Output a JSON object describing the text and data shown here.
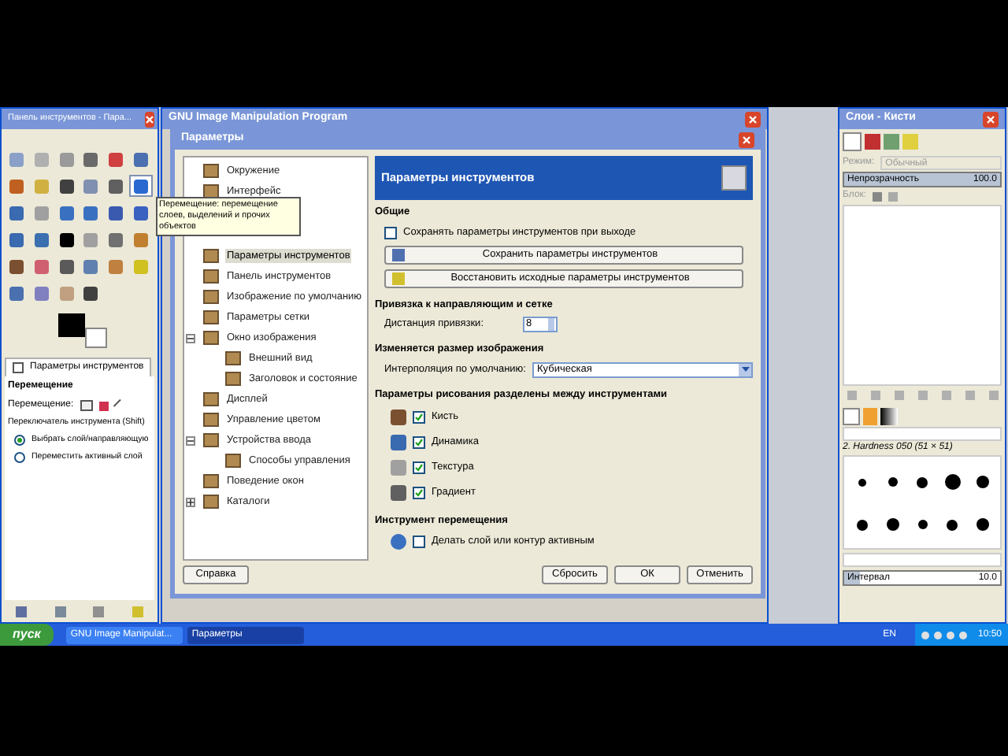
{
  "toolbox": {
    "title": "Панель инструментов - Пара...",
    "tools": [
      {
        "selected": false
      },
      {
        "selected": false
      },
      {
        "selected": false
      },
      {
        "selected": false
      },
      {
        "selected": false
      },
      {
        "selected": false
      },
      {
        "selected": false
      },
      {
        "selected": false
      },
      {
        "selected": false
      },
      {
        "selected": false
      },
      {
        "selected": false
      },
      {
        "selected": true
      },
      {
        "selected": false
      },
      {
        "selected": false
      },
      {
        "selected": false
      },
      {
        "selected": false
      },
      {
        "selected": false
      },
      {
        "selected": false
      },
      {
        "selected": false
      },
      {
        "selected": false
      },
      {
        "selected": false
      },
      {
        "selected": false
      },
      {
        "selected": false
      },
      {
        "selected": false
      },
      {
        "selected": false
      },
      {
        "selected": false
      },
      {
        "selected": false
      },
      {
        "selected": false
      },
      {
        "selected": false
      },
      {
        "selected": false
      },
      {
        "selected": false
      },
      {
        "selected": false
      },
      {
        "selected": false
      },
      {
        "selected": false
      }
    ],
    "options_tab": "Параметры инструментов",
    "section": "Перемещение",
    "move_label": "Перемещение:",
    "switch_label": "Переключатель инструмента (Shift)",
    "radios": [
      {
        "label": "Выбрать слой/направляющую",
        "selected": true
      },
      {
        "label": "Переместить активный слой",
        "selected": false
      }
    ]
  },
  "tooltip": {
    "text": "Перемещение: перемещение слоев, выделений и прочих объектов"
  },
  "main_window": {
    "title": "GNU Image Manipulation Program"
  },
  "dialog": {
    "title": "Параметры",
    "tree_top": [
      {
        "label": "Окружение",
        "selected": false
      },
      {
        "label": "Интерфейс",
        "selected": false
      }
    ],
    "tree": [
      {
        "label": "Параметры инструментов",
        "selected": true
      },
      {
        "label": "Панель инструментов",
        "selected": false
      },
      {
        "label": "Изображение по умолчанию",
        "selected": false
      },
      {
        "label": "Параметры сетки",
        "selected": false
      },
      {
        "label": "Окно изображения",
        "selected": false,
        "expanded": true,
        "children": [
          {
            "label": "Внешний вид",
            "selected": false
          },
          {
            "label": "Заголовок и состояние",
            "selected": false
          }
        ]
      },
      {
        "label": "Дисплей",
        "selected": false
      },
      {
        "label": "Управление цветом",
        "selected": false
      },
      {
        "label": "Устройства ввода",
        "selected": false,
        "expanded": true,
        "children": [
          {
            "label": "Способы управления",
            "selected": false
          }
        ]
      },
      {
        "label": "Поведение окон",
        "selected": false
      },
      {
        "label": "Каталоги",
        "selected": false,
        "expanded": false
      }
    ],
    "header": "Параметры инструментов",
    "general": {
      "heading": "Общие",
      "save_on_exit": {
        "label": "Сохранять параметры инструментов при выходе",
        "checked": false
      },
      "save_button": "Сохранить параметры инструментов",
      "restore_button": "Восстановить исходные параметры инструментов"
    },
    "snap": {
      "heading": "Привязка к направляющим и сетке",
      "label": "Дистанция привязки:",
      "value": "8"
    },
    "scale": {
      "heading": "Изменяется размер изображения",
      "label": "Интерполяция по умолчанию:",
      "value": "Кубическая"
    },
    "paint": {
      "heading": "Параметры рисования разделены между инструментами",
      "items": [
        {
          "label": "Кисть",
          "checked": true
        },
        {
          "label": "Динамика",
          "checked": true
        },
        {
          "label": "Текстура",
          "checked": true
        },
        {
          "label": "Градиент",
          "checked": true
        }
      ]
    },
    "move": {
      "heading": "Инструмент перемещения",
      "option": {
        "label": "Делать слой или контур активным",
        "checked": false
      }
    },
    "buttons": {
      "help": "Справка",
      "reset": "Сбросить",
      "ok": "ОК",
      "cancel": "Отменить"
    }
  },
  "dock": {
    "title": "Слои - Кисти",
    "mode_label": "Режим:",
    "mode_value": "Обычный",
    "opacity": {
      "label": "Непрозрачность",
      "value": "100.0",
      "level": 1
    },
    "lock_label": "Блок:",
    "brush_name": "2. Hardness 050 (51 × 51)",
    "spacing": {
      "label": "Интервал",
      "value": "10.0",
      "level": 0.1
    }
  },
  "taskbar": {
    "start": "пуск",
    "tasks": [
      {
        "label": "GNU Image Manipulat...",
        "selected": false
      },
      {
        "label": "Параметры",
        "selected": true
      }
    ],
    "lang": "EN",
    "clock": "10:50"
  }
}
